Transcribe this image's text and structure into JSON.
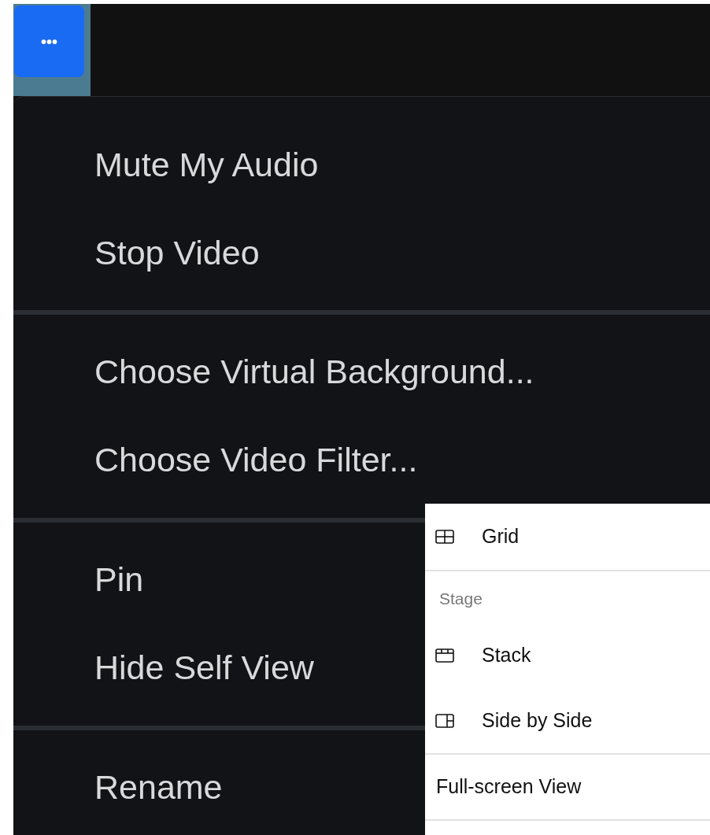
{
  "more_button": {
    "label": "•••"
  },
  "context_menu": {
    "groups": [
      [
        "Mute My Audio",
        "Stop Video"
      ],
      [
        "Choose Virtual Background...",
        "Choose Video Filter..."
      ],
      [
        "Pin",
        "Hide Self View"
      ],
      [
        "Rename"
      ]
    ]
  },
  "view_menu": {
    "sections": [
      [
        {
          "kind": "grid",
          "label": "Grid"
        }
      ],
      [
        {
          "kind": "header",
          "label": "Stage"
        },
        {
          "kind": "stack",
          "label": "Stack"
        },
        {
          "kind": "side",
          "label": "Side by Side"
        }
      ],
      [
        {
          "kind": "plain",
          "label": "Full-screen View"
        }
      ]
    ]
  }
}
